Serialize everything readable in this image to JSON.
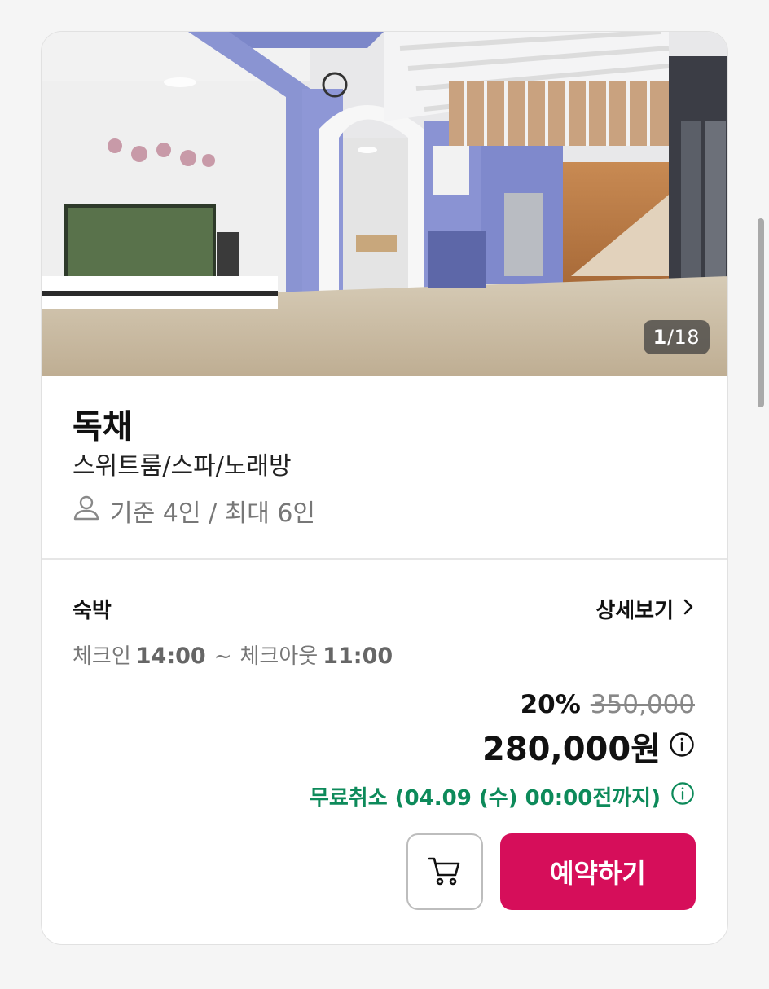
{
  "gallery": {
    "current": "1",
    "separator": "/",
    "total": "18"
  },
  "room": {
    "name": "독채",
    "description": "스위트룸/스파/노래방",
    "capacity": "기준 4인 / 최대 6인"
  },
  "stay": {
    "type_label": "숙박",
    "details_label": "상세보기",
    "checkin_label": "체크인",
    "checkin_time": "14:00",
    "tilde": "~",
    "checkout_label": "체크아웃",
    "checkout_time": "11:00"
  },
  "price": {
    "discount_rate": "20%",
    "original": "350,000",
    "final": "280,000원",
    "cancel_notice": "무료취소 (04.09 (수) 00:00전까지)"
  },
  "actions": {
    "book_label": "예약하기"
  },
  "colors": {
    "accent": "#d60e5a",
    "cancel_green": "#0d8a5a"
  },
  "icons": [
    "person-icon",
    "chevron-right-icon",
    "info-icon",
    "cart-icon"
  ]
}
